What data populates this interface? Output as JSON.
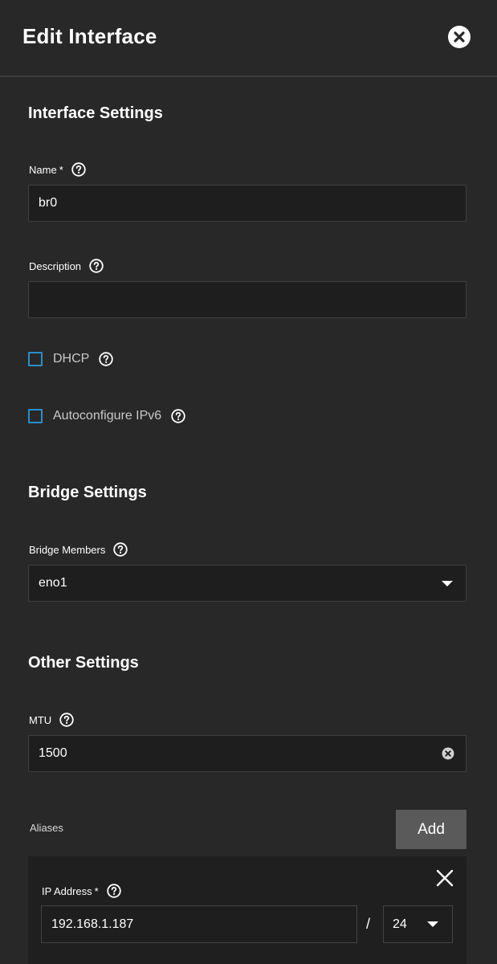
{
  "header": {
    "title": "Edit Interface"
  },
  "interface_settings": {
    "title": "Interface Settings",
    "name_label": "Name",
    "name_value": "br0",
    "description_label": "Description",
    "description_value": "",
    "dhcp_label": "DHCP",
    "dhcp_checked": false,
    "autoconfig_label": "Autoconfigure IPv6",
    "autoconfig_checked": false
  },
  "bridge_settings": {
    "title": "Bridge Settings",
    "members_label": "Bridge Members",
    "members_value": "eno1"
  },
  "other_settings": {
    "title": "Other Settings",
    "mtu_label": "MTU",
    "mtu_value": "1500"
  },
  "aliases": {
    "label": "Aliases",
    "add_label": "Add",
    "items": [
      {
        "ip_label": "IP Address",
        "ip_value": "192.168.1.187",
        "separator": "/",
        "netmask_value": "24"
      }
    ]
  },
  "required_mark": "*",
  "colors": {
    "background": "#282828",
    "input_background": "#1e1e1e",
    "checkbox_border": "#2c8ec8",
    "button_background": "#5a5a5a"
  },
  "icons": {
    "close": "close-circle-icon",
    "help": "help-circle-icon",
    "dropdown": "caret-down-icon",
    "clear": "clear-circle-icon",
    "remove": "x-icon"
  }
}
